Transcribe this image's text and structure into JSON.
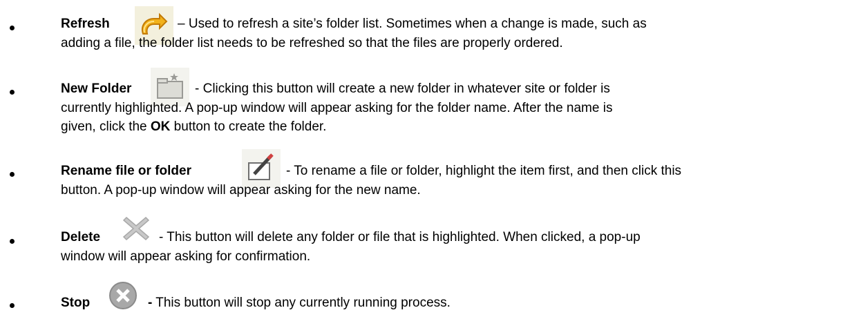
{
  "items": [
    {
      "term": "Refresh",
      "icon": "refresh-icon",
      "line1": "– Used to refresh a site’s folder list. Sometimes when a change is made, such as",
      "line2": "adding a file, the folder list needs to be refreshed so that the files are properly ordered."
    },
    {
      "term": "New Folder",
      "icon": "new-folder-icon",
      "line1": "- Clicking this button will create a new folder in whatever site or folder is",
      "line2": "currently highlighted. A pop-up window will appear asking for the folder name. After the name is",
      "line3_pre": "given, click the ",
      "line3_bold": "OK",
      "line3_post": " button to create the folder."
    },
    {
      "term": "Rename file or folder",
      "icon": "rename-icon",
      "line1": "- To rename a file or folder, highlight the item first, and then click this",
      "line2": "button. A pop-up window will appear asking for the new name."
    },
    {
      "term": "Delete",
      "icon": "delete-icon",
      "line1": "- This button will delete any folder or file that is highlighted. When clicked, a pop-up",
      "line2": "window will appear asking for confirmation."
    },
    {
      "term": "Stop",
      "icon": "stop-icon",
      "line1_bold": "-",
      "line1": " This button will stop any currently running process."
    }
  ]
}
